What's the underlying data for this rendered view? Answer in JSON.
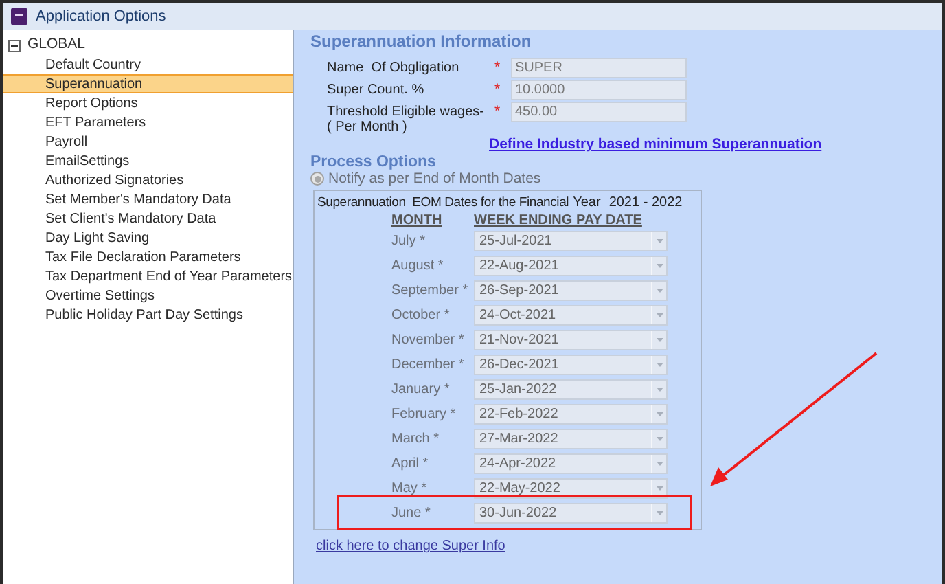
{
  "window": {
    "title": "Application Options"
  },
  "tree": {
    "label": "GLOBAL",
    "expanded": true,
    "children": [
      {
        "label": "Default Country",
        "selected": false
      },
      {
        "label": "Superannuation",
        "selected": true
      },
      {
        "label": "Report Options",
        "selected": false
      },
      {
        "label": "EFT Parameters",
        "selected": false
      },
      {
        "label": "Payroll",
        "selected": false
      },
      {
        "label": "EmailSettings",
        "selected": false
      },
      {
        "label": "Authorized Signatories",
        "selected": false
      },
      {
        "label": "Set Member's Mandatory Data",
        "selected": false
      },
      {
        "label": "Set Client's Mandatory Data",
        "selected": false
      },
      {
        "label": "Day Light Saving",
        "selected": false
      },
      {
        "label": "Tax File Declaration Parameters",
        "selected": false
      },
      {
        "label": "Tax Department End of Year Parameters",
        "selected": false
      },
      {
        "label": "Overtime Settings",
        "selected": false
      },
      {
        "label": "Public Holiday Part Day Settings",
        "selected": false
      }
    ]
  },
  "info": {
    "title": "Superannuation Information",
    "fields": [
      {
        "label": "Name  Of Obgligation",
        "required": "*",
        "value": "SUPER"
      },
      {
        "label": "Super Count. %",
        "required": "*",
        "value": "10.0000"
      },
      {
        "label": "Threshold Eligible wages-\n( Per Month )",
        "required": "*",
        "value": "450.00"
      }
    ],
    "link": "Define Industry based minimum Superannuation"
  },
  "process": {
    "title": "Process Options",
    "option": {
      "label": "Notify as per End of Month Dates",
      "selected": true,
      "disabled": true
    }
  },
  "eom": {
    "title": "Superannuation  EOM Dates for the Financial",
    "year_label": "Year",
    "year": "2021 - 2022",
    "col_month": "MONTH",
    "col_date": "WEEK ENDING PAY DATE",
    "months": [
      {
        "month": "July",
        "required": "*",
        "date": "25-Jul-2021",
        "highlighted": false
      },
      {
        "month": "August",
        "required": "*",
        "date": "22-Aug-2021",
        "highlighted": false
      },
      {
        "month": "September",
        "required": "*",
        "date": "26-Sep-2021",
        "highlighted": false
      },
      {
        "month": "October",
        "required": "*",
        "date": "24-Oct-2021",
        "highlighted": false
      },
      {
        "month": "November",
        "required": "*",
        "date": "21-Nov-2021",
        "highlighted": false
      },
      {
        "month": "December",
        "required": "*",
        "date": "26-Dec-2021",
        "highlighted": false
      },
      {
        "month": "January",
        "required": "*",
        "date": "25-Jan-2022",
        "highlighted": false
      },
      {
        "month": "February",
        "required": "*",
        "date": "22-Feb-2022",
        "highlighted": false
      },
      {
        "month": "March",
        "required": "*",
        "date": "27-Mar-2022",
        "highlighted": false
      },
      {
        "month": "April",
        "required": "*",
        "date": "24-Apr-2022",
        "highlighted": false
      },
      {
        "month": "May",
        "required": "*",
        "date": "22-May-2022",
        "highlighted": false
      },
      {
        "month": "June",
        "required": "*",
        "date": "30-Jun-2022",
        "highlighted": true
      }
    ]
  },
  "change_link": "click here to change Super Info"
}
